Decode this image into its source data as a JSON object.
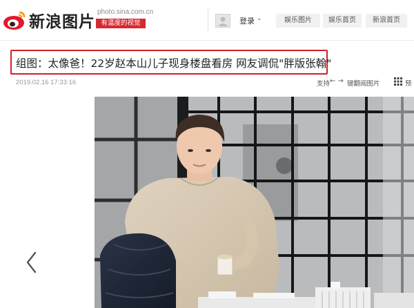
{
  "header": {
    "logo_text": "新浪图片",
    "site_url": "photo.sina.com.cn",
    "slogan": "有温度的视觉",
    "login_label": "登录",
    "nav_tabs": [
      "娱乐图片",
      "娱乐首页",
      "新浪首页"
    ]
  },
  "article": {
    "title": "组图：太像爸！22岁赵本山儿子现身楼盘看房 网友调侃\"胖版张翰\"",
    "date": "2019.02.16 17:33:16",
    "support_label": "支持",
    "keyboard_label": "键翻阅图片",
    "more_label": "预"
  },
  "colors": {
    "brand_red": "#d7282f",
    "title_border": "#cf2027"
  },
  "icons": [
    "weibo-eye-icon",
    "avatar-icon",
    "chevron-down-icon",
    "left-right-arrows-icon",
    "grid-icon",
    "prev-arrow-icon"
  ]
}
